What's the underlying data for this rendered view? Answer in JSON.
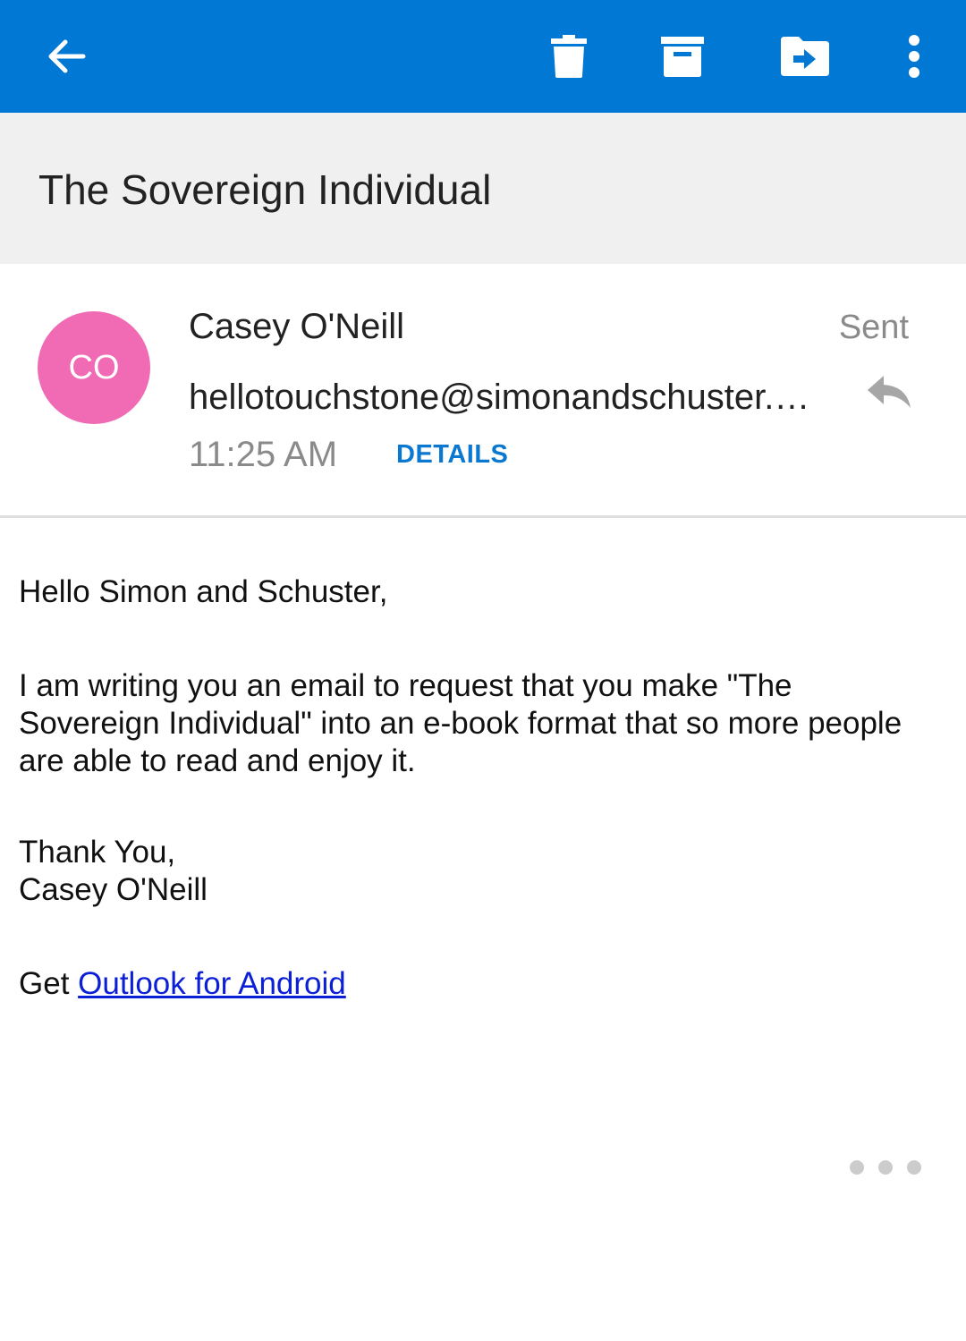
{
  "toolbar": {
    "background_color": "#0078d4",
    "icons": [
      "arrow-left-icon",
      "trash-icon",
      "archive-icon",
      "move-to-folder-icon",
      "more-vertical-icon"
    ]
  },
  "subject": "The Sovereign Individual",
  "message_header": {
    "avatar_initials": "CO",
    "avatar_color": "#f06bb4",
    "sender_name": "Casey O'Neill",
    "folder_label": "Sent",
    "recipient": "hellotouchstone@simonandschuster.com",
    "time": "11:25 AM",
    "details_label": "DETAILS",
    "accent_color": "#0a78d1"
  },
  "body": {
    "greeting": "Hello Simon and Schuster,",
    "paragraph_lines": [
      "I am writing you an email to request that you make \"The",
      "Sovereign Individual\" into an e-book format that so more people",
      "are able to read and enjoy it."
    ],
    "closing": "Thank You,",
    "signature": "Casey O'Neill",
    "footer_prefix": "Get ",
    "footer_link": "Outlook for Android"
  }
}
